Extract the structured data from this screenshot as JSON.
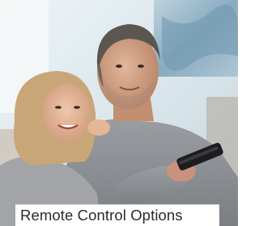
{
  "product_tile": {
    "image_alt": "Couple watching TV with remote control",
    "caption": "Remote Control Options"
  },
  "colors": {
    "wall": "#d8e6ee",
    "painting": "#8fb2c6",
    "sweater": "#8c8f93",
    "caption_bg": "#ffffff",
    "caption_text": "#2a2a2a"
  }
}
